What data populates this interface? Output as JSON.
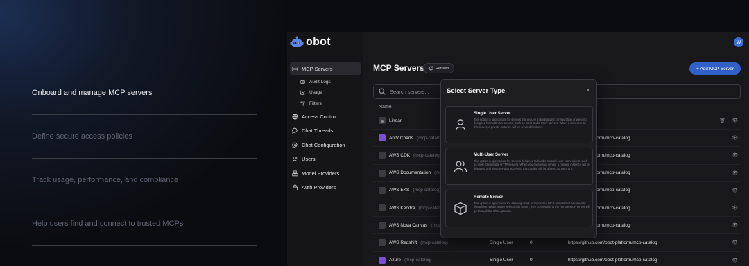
{
  "features": [
    {
      "label": "Onboard and manage MCP servers",
      "active": true
    },
    {
      "label": "Define secure access policies",
      "active": false
    },
    {
      "label": "Track usage, performance, and compliance",
      "active": false
    },
    {
      "label": "Help users find and connect to trusted MCPs",
      "active": false
    }
  ],
  "app": {
    "logo": "obot",
    "avatar": "W",
    "nav": {
      "mcp_servers": "MCP Servers",
      "audit_logs": "Audit Logs",
      "usage": "Usage",
      "filters": "Filters",
      "access_control": "Access Control",
      "chat_threads": "Chat Threads",
      "chat_configuration": "Chat Configuration",
      "users": "Users",
      "model_providers": "Model Providers",
      "auth_providers": "Auth Providers"
    },
    "page_title": "MCP Servers",
    "refresh_label": "Refresh",
    "add_button": "+ Add MCP Server",
    "search_placeholder": "Search servers...",
    "table_header_name": "Name",
    "rows": [
      {
        "name": "Linear",
        "catalog": "",
        "type": "",
        "count": "",
        "url": "",
        "icon_color": "#3a3a40"
      },
      {
        "name": "AntV Charts",
        "catalog": "(mcp-catalog)",
        "type": "",
        "count": "",
        "url": "com/obot-platform/mcp-catalog",
        "icon_color": "#7b4fd8"
      },
      {
        "name": "AWS CDK",
        "catalog": "(mcp-catalog)",
        "type": "",
        "count": "",
        "url": "com/obot-platform/mcp-catalog",
        "icon_color": "#3b3b40"
      },
      {
        "name": "AWS Documentation",
        "catalog": "(mcp-catalog)",
        "type": "",
        "count": "",
        "url": "com/obot-platform/mcp-catalog",
        "icon_color": "#3b3b40"
      },
      {
        "name": "AWS EKS",
        "catalog": "(mcp-catalog)",
        "type": "",
        "count": "",
        "url": "com/obot-platform/mcp-catalog",
        "icon_color": "#3b3b40"
      },
      {
        "name": "AWS Kendra",
        "catalog": "(mcp-catalog)",
        "type": "",
        "count": "",
        "url": "com/obot-platform/mcp-catalog",
        "icon_color": "#3b3b40"
      },
      {
        "name": "AWS Nova Canvas",
        "catalog": "(mcp-catalog)",
        "type": "",
        "count": "",
        "url": "com/obot-platform/mcp-catalog",
        "icon_color": "#3b3b40"
      },
      {
        "name": "AWS Redshift",
        "catalog": "(mcp-catalog)",
        "type": "Single User",
        "count": "0",
        "url": "https://github.com/obot-platform/mcp-catalog",
        "icon_color": "#3b3b40"
      },
      {
        "name": "Azure",
        "catalog": "(mcp-catalog)",
        "type": "Single User",
        "count": "0",
        "url": "https://github.com/obot-platform/mcp-catalog",
        "icon_color": "#7b4fd8"
      }
    ]
  },
  "modal": {
    "title": "Select Server Type",
    "close": "×",
    "options": [
      {
        "title": "Single User Server",
        "description": "This option is appropriate for servers that require individualized configuration or were not designed for multi-user access, such as most studio MCP servers. When a user selects this server, a private instance will be created for them."
      },
      {
        "title": "Multi-User Server",
        "description": "This option is appropriate for servers designed to handle multiple user connections, such as most Streamable HTTP servers. When you create this server, a running instance will be deployed and any user with access to this catalog will be able to connect to it."
      },
      {
        "title": "Remote Server",
        "description": "This option is appropriate for allowing users to connect to MCP servers that are already elsewhere. When a user selects this server, their connection to the remote MCP server will go through the Obot gateway."
      }
    ]
  },
  "colors": {
    "accent": "#3160c9",
    "background": "#18181b",
    "sidebar": "#151517"
  },
  "icons": [
    "robot-logo-icon",
    "server-icon",
    "list-icon",
    "chart-icon",
    "filter-icon",
    "globe-icon",
    "chat-icon",
    "sliders-icon",
    "users-icon",
    "cubes-icon",
    "lock-icon",
    "search-icon",
    "refresh-icon",
    "trash-icon",
    "eye-icon",
    "close-icon",
    "user-icon",
    "users-group-icon",
    "box-icon"
  ]
}
